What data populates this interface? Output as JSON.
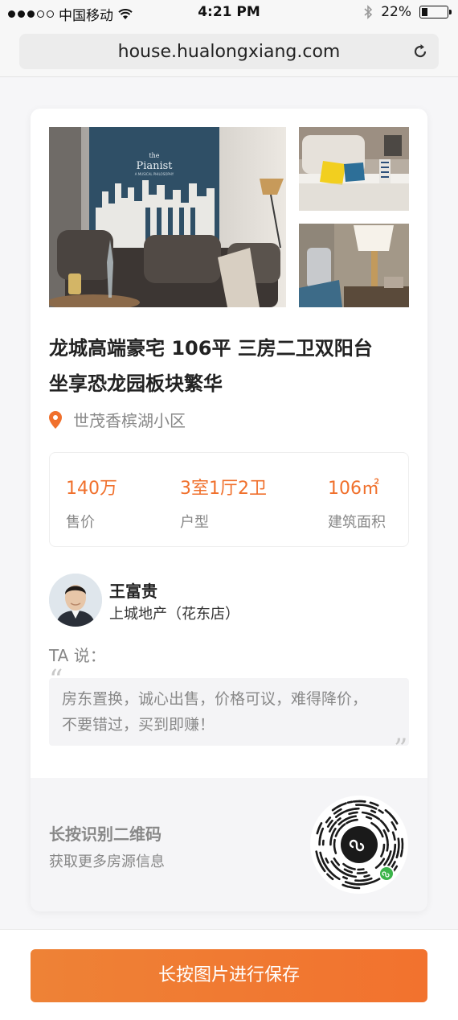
{
  "status_bar": {
    "carrier": "中国移动",
    "time": "4:21 PM",
    "battery": "22%",
    "battery_level": 0.22,
    "icons": [
      "signal-dots-icon",
      "wifi-icon",
      "bluetooth-icon",
      "battery-icon"
    ]
  },
  "browser": {
    "url": "house.hualongxiang.com",
    "reload_icon": "reload-icon"
  },
  "listing": {
    "title_line1": "龙城高端豪宅 106平 三房二卫双阳台",
    "title_line2": "坐享恐龙园板块繁华",
    "location_icon": "location-pin-icon",
    "location": "世茂香槟湖小区",
    "photos": {
      "main_art_title": "the",
      "main_art_brand": "Pianist",
      "main_art_caption": "A MUSICAL PHILOSOPHY"
    },
    "stats": [
      {
        "value": "140万",
        "label": "售价"
      },
      {
        "value": "3室1厅2卫",
        "label": "户型"
      },
      {
        "value": "106㎡",
        "label": "建筑面积"
      }
    ]
  },
  "agent": {
    "name": "王富贵",
    "company": "上城地产（花东店）",
    "says_label": "TA 说：",
    "quote_open": "“",
    "quote_close": "”",
    "quote_line1": "房东置换，诚心出售，价格可议，难得降价，",
    "quote_line2": "不要错过，买到即赚！"
  },
  "qr_section": {
    "line1": "长按识别二维码",
    "line2": "获取更多房源信息"
  },
  "footer": {
    "save_label": "长按图片进行保存"
  },
  "colors": {
    "accent": "#f0702c",
    "button": "#f07a32",
    "muted": "#888888"
  }
}
